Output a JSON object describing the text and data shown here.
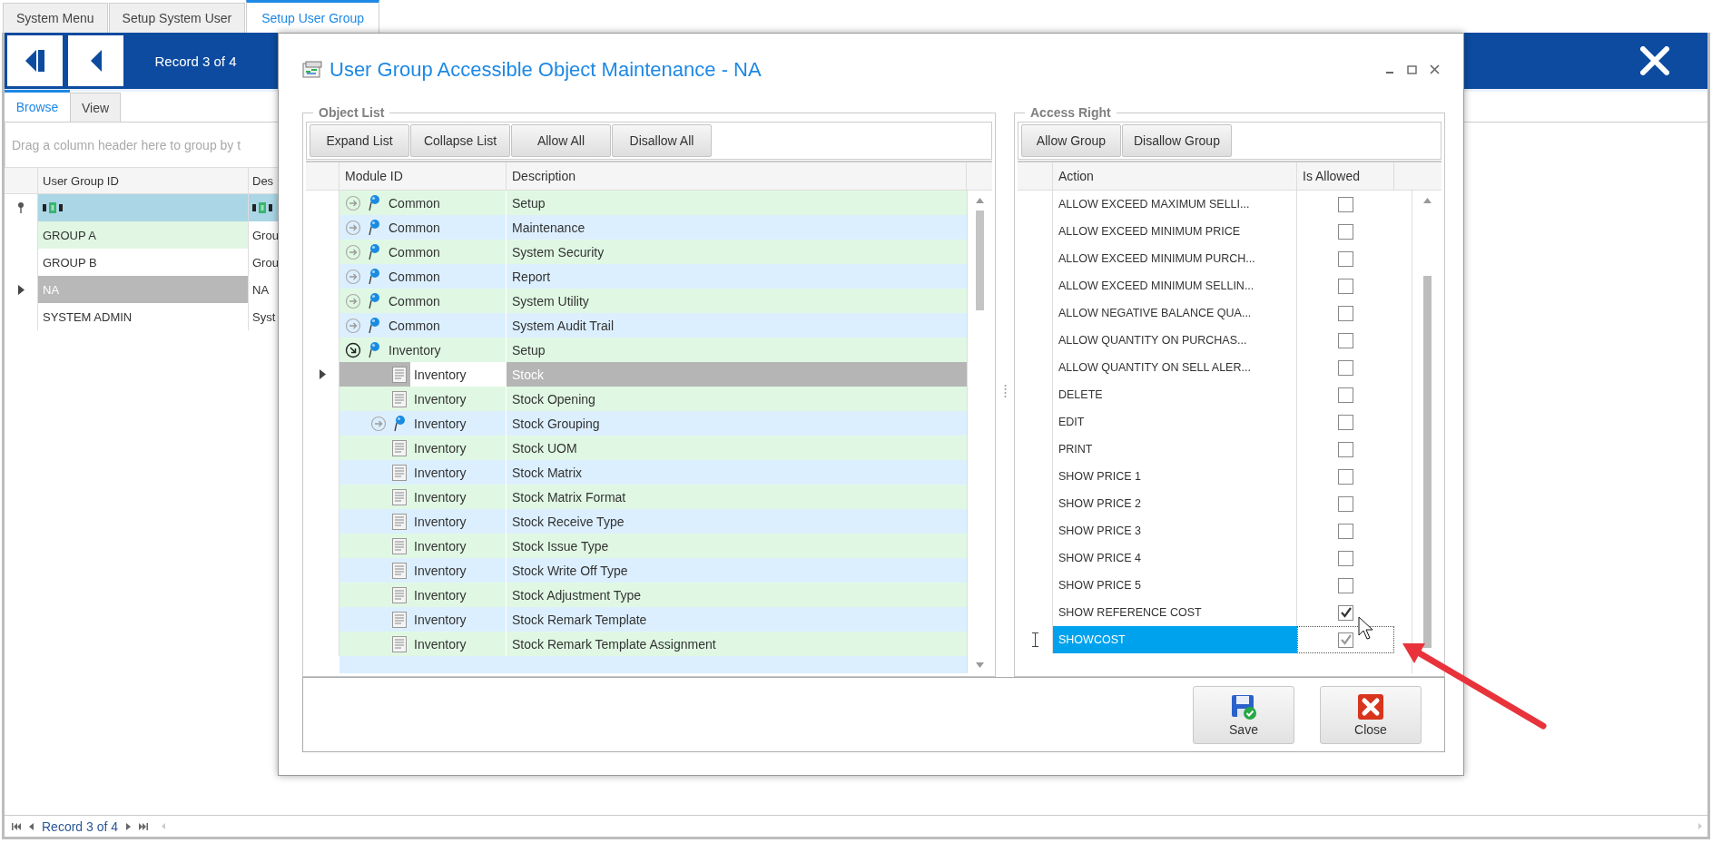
{
  "tabs": [
    {
      "label": "System Menu",
      "selected": false
    },
    {
      "label": "Setup System User",
      "selected": false
    },
    {
      "label": "Setup User Group",
      "selected": true
    }
  ],
  "navigator": {
    "record": "Record 3 of 4"
  },
  "view_tabs": [
    {
      "label": "Browse",
      "selected": true
    },
    {
      "label": "View",
      "selected": false
    }
  ],
  "group_panel": {
    "hint": "Drag a column header here to group by t"
  },
  "grid": {
    "columns": [
      "User Group ID",
      "Des"
    ],
    "rows": [
      {
        "cells": [
          "GROUP A",
          "Grou"
        ],
        "selected": false
      },
      {
        "cells": [
          "GROUP B",
          "Grou"
        ],
        "selected": false
      },
      {
        "cells": [
          "NA",
          "NA"
        ],
        "selected": true
      },
      {
        "cells": [
          "SYSTEM ADMIN",
          "Syst"
        ],
        "selected": false
      }
    ]
  },
  "dialog": {
    "title": "User Group Accessible Object Maintenance - NA",
    "object_list": {
      "legend": "Object List",
      "buttons": [
        "Expand List",
        "Collapse List",
        "Allow All",
        "Disallow All"
      ],
      "columns": [
        "Module ID",
        "Description"
      ],
      "items": [
        {
          "module": "Common",
          "description": "Setup",
          "kind": "group",
          "expanded": false,
          "selected": false
        },
        {
          "module": "Common",
          "description": "Maintenance",
          "kind": "group",
          "expanded": false,
          "selected": false
        },
        {
          "module": "Common",
          "description": "System Security",
          "kind": "group",
          "expanded": false,
          "selected": false
        },
        {
          "module": "Common",
          "description": "Report",
          "kind": "group",
          "expanded": false,
          "selected": false
        },
        {
          "module": "Common",
          "description": "System Utility",
          "kind": "group",
          "expanded": false,
          "selected": false
        },
        {
          "module": "Common",
          "description": "System Audit Trail",
          "kind": "group",
          "expanded": false,
          "selected": false
        },
        {
          "module": "Inventory",
          "description": "Setup",
          "kind": "group",
          "expanded": true,
          "selected": false,
          "children": [
            {
              "module": "Inventory",
              "description": "Stock",
              "kind": "object",
              "selected": true
            },
            {
              "module": "Inventory",
              "description": "Stock Opening",
              "kind": "object",
              "selected": false
            },
            {
              "module": "Inventory",
              "description": "Stock Grouping",
              "kind": "group",
              "expanded": false,
              "selected": false
            },
            {
              "module": "Inventory",
              "description": "Stock UOM",
              "kind": "object",
              "selected": false
            },
            {
              "module": "Inventory",
              "description": "Stock Matrix",
              "kind": "object",
              "selected": false
            },
            {
              "module": "Inventory",
              "description": "Stock Matrix Format",
              "kind": "object",
              "selected": false
            },
            {
              "module": "Inventory",
              "description": "Stock Receive Type",
              "kind": "object",
              "selected": false
            },
            {
              "module": "Inventory",
              "description": "Stock Issue Type",
              "kind": "object",
              "selected": false
            },
            {
              "module": "Inventory",
              "description": "Stock Write Off Type",
              "kind": "object",
              "selected": false
            },
            {
              "module": "Inventory",
              "description": "Stock Adjustment Type",
              "kind": "object",
              "selected": false
            },
            {
              "module": "Inventory",
              "description": "Stock Remark Template",
              "kind": "object",
              "selected": false
            },
            {
              "module": "Inventory",
              "description": "Stock Remark Template Assignment",
              "kind": "object",
              "selected": false
            }
          ]
        }
      ]
    },
    "access_right": {
      "legend": "Access Right",
      "buttons": [
        "Allow Group",
        "Disallow Group"
      ],
      "columns": [
        "Action",
        "Is Allowed"
      ],
      "rows": [
        {
          "action": "ALLOW EXCEED MAXIMUM SELLI...",
          "allowed": false,
          "selected": false
        },
        {
          "action": "ALLOW EXCEED MINIMUM PRICE",
          "allowed": false,
          "selected": false
        },
        {
          "action": "ALLOW EXCEED MINIMUM PURCH...",
          "allowed": false,
          "selected": false
        },
        {
          "action": "ALLOW EXCEED MINIMUM SELLIN...",
          "allowed": false,
          "selected": false
        },
        {
          "action": "ALLOW NEGATIVE BALANCE QUA...",
          "allowed": false,
          "selected": false
        },
        {
          "action": "ALLOW QUANTITY ON PURCHAS...",
          "allowed": false,
          "selected": false
        },
        {
          "action": "ALLOW QUANTITY ON SELL ALER...",
          "allowed": false,
          "selected": false
        },
        {
          "action": "DELETE",
          "allowed": false,
          "selected": false
        },
        {
          "action": "EDIT",
          "allowed": false,
          "selected": false
        },
        {
          "action": "PRINT",
          "allowed": false,
          "selected": false
        },
        {
          "action": "SHOW PRICE 1",
          "allowed": false,
          "selected": false
        },
        {
          "action": "SHOW PRICE 2",
          "allowed": false,
          "selected": false
        },
        {
          "action": "SHOW PRICE 3",
          "allowed": false,
          "selected": false
        },
        {
          "action": "SHOW PRICE 4",
          "allowed": false,
          "selected": false
        },
        {
          "action": "SHOW PRICE 5",
          "allowed": false,
          "selected": false
        },
        {
          "action": "SHOW REFERENCE COST",
          "allowed": true,
          "selected": false
        },
        {
          "action": "SHOWCOST",
          "allowed": true,
          "selected": true
        }
      ]
    },
    "buttons": [
      {
        "label": "Save",
        "kind": "save"
      },
      {
        "label": "Close",
        "kind": "close"
      }
    ]
  },
  "footer": {
    "record": "Record 3 of 4"
  }
}
